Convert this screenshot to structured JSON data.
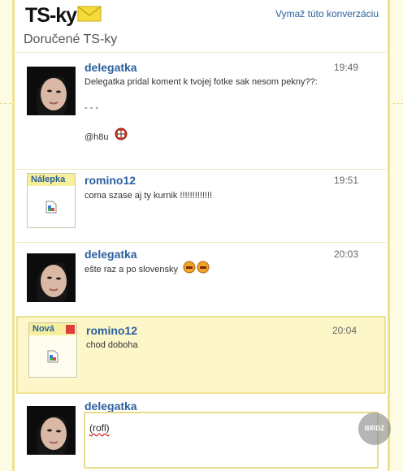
{
  "header": {
    "logo_text": "TS-ky",
    "clear_link": "Vymaž túto konverzáciu",
    "inbox_title": "Doručené TS-ky"
  },
  "messages": [
    {
      "user": "delegatka",
      "time": "19:49",
      "lines": [
        "Delegatka pridal koment k tvojej fotke sak nesom pekny??:",
        "",
        "- - -",
        "",
        "@h8u"
      ],
      "avatar": "photo",
      "emoticon": "grin-emoticon"
    },
    {
      "user": "romino12",
      "time": "19:51",
      "lines": [
        "coma szase aj ty kurnik !!!!!!!!!!!!!"
      ],
      "sticker_label": "Nálepka"
    },
    {
      "user": "delegatka",
      "time": "20:03",
      "lines": [
        "ešte raz a po slovensky"
      ],
      "avatar": "photo",
      "emoticon": "eyes-emoticon"
    },
    {
      "user": "romino12",
      "time": "20:04",
      "lines": [
        "chod doboha"
      ],
      "sticker_label": "Nová",
      "is_new": true
    }
  ],
  "reply": {
    "user": "delegatka",
    "text": "(rofl)"
  },
  "watermark": "BIRDZ",
  "colors": {
    "background": "#fdfbe3",
    "panel_border": "#efe28e",
    "username": "#2a5f9e",
    "new_highlight": "#fcf6c8",
    "new_flag": "#dd3d3d"
  }
}
